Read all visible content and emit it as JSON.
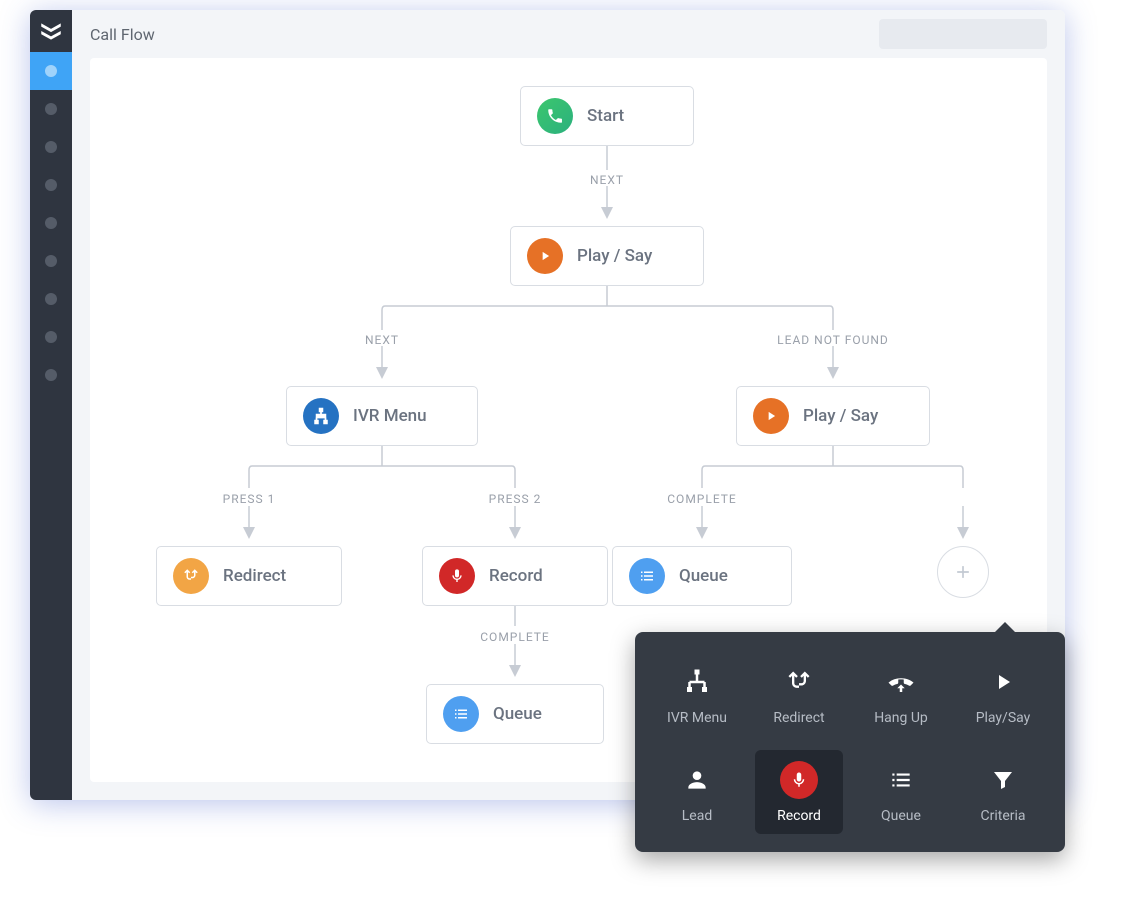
{
  "header": {
    "title": "Call Flow"
  },
  "flow": {
    "start": {
      "label": "Start",
      "icon": "phone-icon",
      "color": "green"
    },
    "play_say_root": {
      "label": "Play / Say",
      "icon": "play-icon",
      "color": "orange"
    },
    "edges": {
      "start_next": "NEXT",
      "root_next": "NEXT",
      "root_lead_not_found": "LEAD NOT FOUND",
      "ivr_press1": "PRESS 1",
      "ivr_press2": "PRESS 2",
      "playsay2_complete": "COMPLETE",
      "record_complete": "COMPLETE"
    },
    "ivr_menu": {
      "label": "IVR Menu",
      "icon": "sitemap-icon",
      "color": "blue"
    },
    "play_say_2": {
      "label": "Play / Say",
      "icon": "play-icon",
      "color": "orange"
    },
    "redirect": {
      "label": "Redirect",
      "icon": "split-icon",
      "color": "amber"
    },
    "record": {
      "label": "Record",
      "icon": "mic-icon",
      "color": "red"
    },
    "queue_left": {
      "label": "Queue",
      "icon": "list-icon",
      "color": "lblue"
    },
    "queue_right": {
      "label": "Queue",
      "icon": "list-icon",
      "color": "lblue"
    }
  },
  "picker": {
    "items": [
      {
        "id": "ivr",
        "label": "IVR Menu",
        "icon": "sitemap-icon"
      },
      {
        "id": "redirect",
        "label": "Redirect",
        "icon": "split-icon"
      },
      {
        "id": "hangup",
        "label": "Hang Up",
        "icon": "hangup-icon"
      },
      {
        "id": "playsay",
        "label": "Play/Say",
        "icon": "play-solid-icon"
      },
      {
        "id": "lead",
        "label": "Lead",
        "icon": "person-icon"
      },
      {
        "id": "record",
        "label": "Record",
        "icon": "mic-icon",
        "selected": true
      },
      {
        "id": "queue",
        "label": "Queue",
        "icon": "list-icon"
      },
      {
        "id": "criteria",
        "label": "Criteria",
        "icon": "funnel-icon"
      }
    ]
  }
}
